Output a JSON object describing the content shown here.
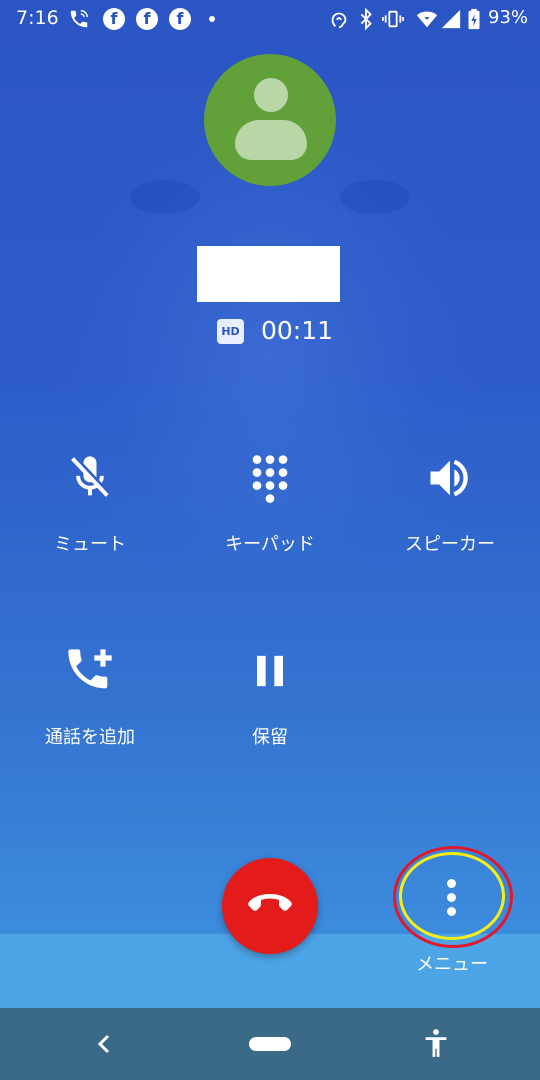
{
  "status_bar": {
    "time": "7:16",
    "icons": [
      "phone-wifi-icon",
      "facebook-icon",
      "facebook-icon",
      "facebook-icon",
      "dot-icon",
      "nfc-icon",
      "bluetooth-icon",
      "vibrate-icon",
      "wifi-icon",
      "signal-icon",
      "battery-icon"
    ],
    "facebook_glyph": "f",
    "battery_percent": "93%"
  },
  "call": {
    "caller_name": "",
    "hd_badge": "HD",
    "duration": "00:11"
  },
  "actions": {
    "mute": "ミュート",
    "keypad": "キーパッド",
    "speaker": "スピーカー",
    "add_call": "通話を追加",
    "hold": "保留"
  },
  "bottom": {
    "menu_label": "メニュー"
  },
  "colors": {
    "end_call": "#e31b1b",
    "avatar": "#62a03a",
    "highlight_outer": "#e2182a",
    "highlight_inner": "#f7ee14"
  }
}
